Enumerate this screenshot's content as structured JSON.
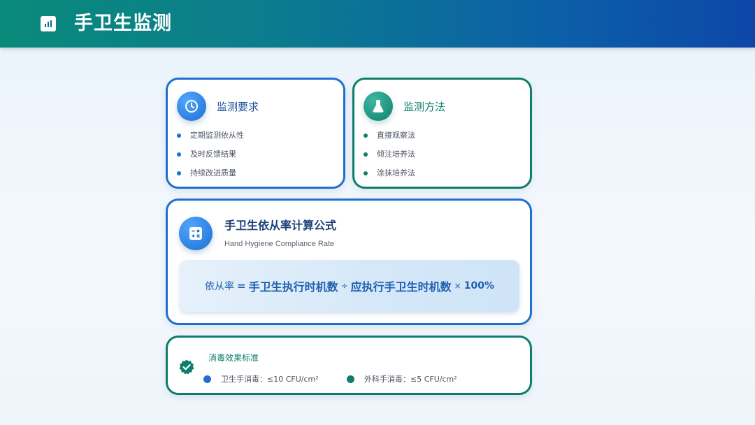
{
  "header": {
    "title": "手卫生监测",
    "icon": "bar-chart-icon"
  },
  "requirements": {
    "title": "监测要求",
    "icon": "clock-icon",
    "items": [
      "定期监测依从性",
      "及时反馈结果",
      "持续改进质量"
    ]
  },
  "methods": {
    "title": "监测方法",
    "icon": "flask-icon",
    "items": [
      "直接观察法",
      "倾注培养法",
      "涂抹培养法"
    ]
  },
  "formula": {
    "icon": "calculator-icon",
    "title": "手卫生依从率计算公式",
    "subtitle": "Hand Hygiene Compliance Rate",
    "label": "依从率",
    "equals": "=",
    "numerator": "手卫生执行时机数",
    "divide": "÷",
    "denominator": "应执行手卫生时机数",
    "times": "×",
    "percent": "100%"
  },
  "standards": {
    "icon": "verified-badge-icon",
    "title": "消毒效果标准",
    "items": [
      {
        "label": "卫生手消毒：≤10 CFU/cm²"
      },
      {
        "label": "外科手消毒：≤5 CFU/cm²"
      }
    ]
  },
  "colors": {
    "blue": "#1f6fd1",
    "green": "#0e7e6c",
    "header_start": "#0a8a7a",
    "header_end": "#0d47a8"
  }
}
